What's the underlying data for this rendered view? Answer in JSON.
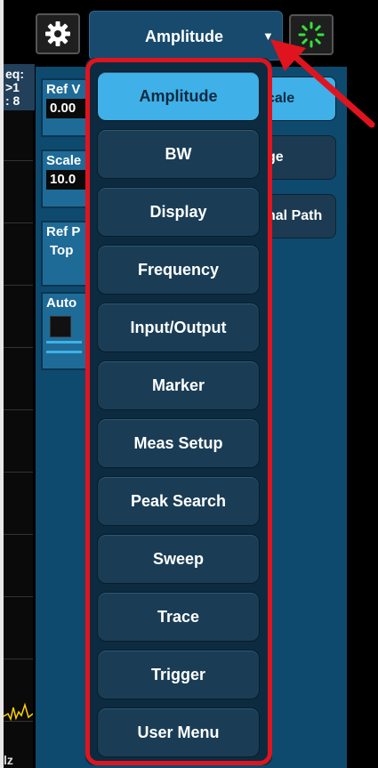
{
  "readout": {
    "line1": "eq:",
    "line2": ">1",
    "line3": ": 8"
  },
  "left_fields": {
    "ref_value": {
      "label": "Ref V",
      "value": "0.00"
    },
    "scale": {
      "label": "Scale",
      "value": "10.0"
    },
    "ref_pos": {
      "label": "Ref P",
      "value": "Top"
    },
    "auto": {
      "label": "Auto"
    }
  },
  "side_buttons": [
    "cale",
    "ge",
    "nal Path"
  ],
  "top_bar": {
    "menu_label": "Amplitude",
    "settings_icon": "gear-icon",
    "busy_icon": "spinner-icon"
  },
  "dropdown": {
    "items": [
      "Amplitude",
      "BW",
      "Display",
      "Frequency",
      "Input/Output",
      "Marker",
      "Meas Setup",
      "Peak Search",
      "Sweep",
      "Trace",
      "Trigger",
      "User Menu"
    ],
    "selected": "Amplitude"
  },
  "bottom_label": "lz",
  "colors": {
    "accent": "#3fb0e8",
    "panel": "#0e4a6e",
    "menu_item": "#1a3d55",
    "highlight_outline": "#e0141e",
    "spinner": "#35e23a"
  }
}
